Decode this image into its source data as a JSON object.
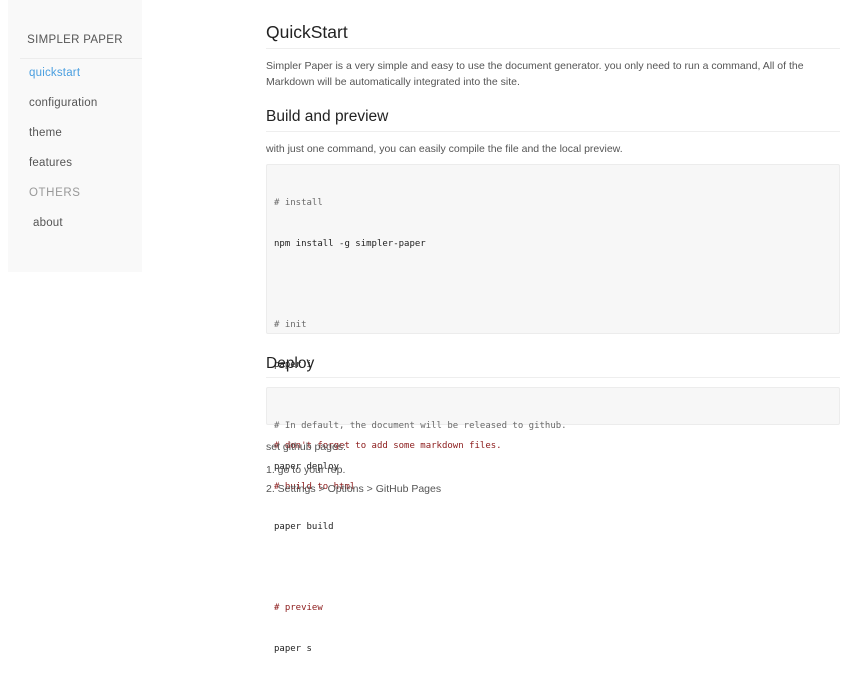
{
  "sidebar": {
    "brand": "SIMPLER PAPER",
    "items": [
      {
        "label": "quickstart"
      },
      {
        "label": "configuration"
      },
      {
        "label": "theme"
      },
      {
        "label": "features"
      }
    ],
    "section": "OTHERS",
    "sub_items": [
      {
        "label": "about"
      }
    ]
  },
  "main": {
    "title": "QuickStart",
    "intro": "Simpler Paper is a very simple and easy to use the document generator. you only need to run a command, All of the Markdown will be automatically integrated into the site.",
    "build": {
      "heading": "Build and preview",
      "text": "with just one command, you can easily compile the file and the local preview.",
      "code": [
        "# install",
        "npm install -g simpler-paper",
        "",
        "# init",
        "paper i",
        "",
        "# don't forget to add some markdown files.",
        "# build to html",
        "paper build",
        "",
        "# preview",
        "paper s"
      ]
    },
    "deploy": {
      "heading": "Deploy",
      "code": [
        "# In default, the document will be released to github.",
        "paper deploy"
      ],
      "pages_text": "set github pages:",
      "steps": [
        "1. go to your rep.",
        "2. Settings > Options > GitHub Pages"
      ]
    }
  }
}
